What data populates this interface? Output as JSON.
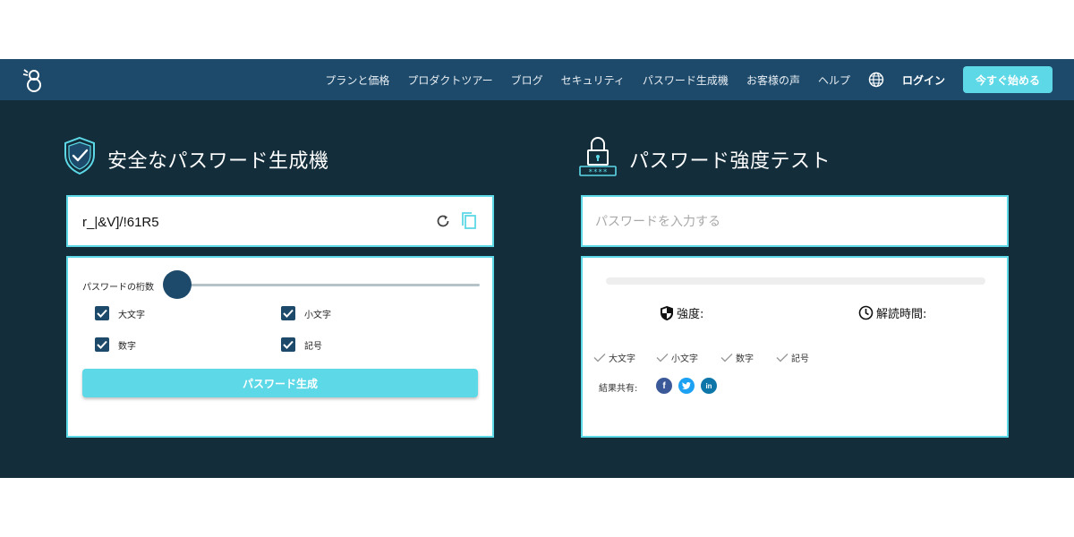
{
  "header": {
    "nav": [
      "プランと価格",
      "プロダクトツアー",
      "ブログ",
      "セキュリティ",
      "パスワード生成機",
      "お客様の声",
      "ヘルプ"
    ],
    "login": "ログイン",
    "cta": "今すぐ始める"
  },
  "generator": {
    "title": "安全なパスワード生成機",
    "password": "r_|&V]/!61R5",
    "length_label": "パスワードの桁数",
    "length_fraction": 0.0,
    "options": [
      {
        "label": "大文字",
        "checked": true
      },
      {
        "label": "小文字",
        "checked": true
      },
      {
        "label": "数字",
        "checked": true
      },
      {
        "label": "記号",
        "checked": true
      }
    ],
    "generate_button": "パスワード生成"
  },
  "tester": {
    "title": "パスワード強度テスト",
    "placeholder": "パスワードを入力する",
    "strength_label": "強度:",
    "crack_time_label": "解読時間:",
    "criteria": [
      "大文字",
      "小文字",
      "数字",
      "記号"
    ],
    "share_label": "結果共有:",
    "social": [
      "facebook-icon",
      "twitter-icon",
      "linkedin-icon"
    ]
  },
  "colors": {
    "header_bg": "#1d4a6b",
    "main_bg": "#132d3b",
    "accent": "#5dd8e6"
  }
}
